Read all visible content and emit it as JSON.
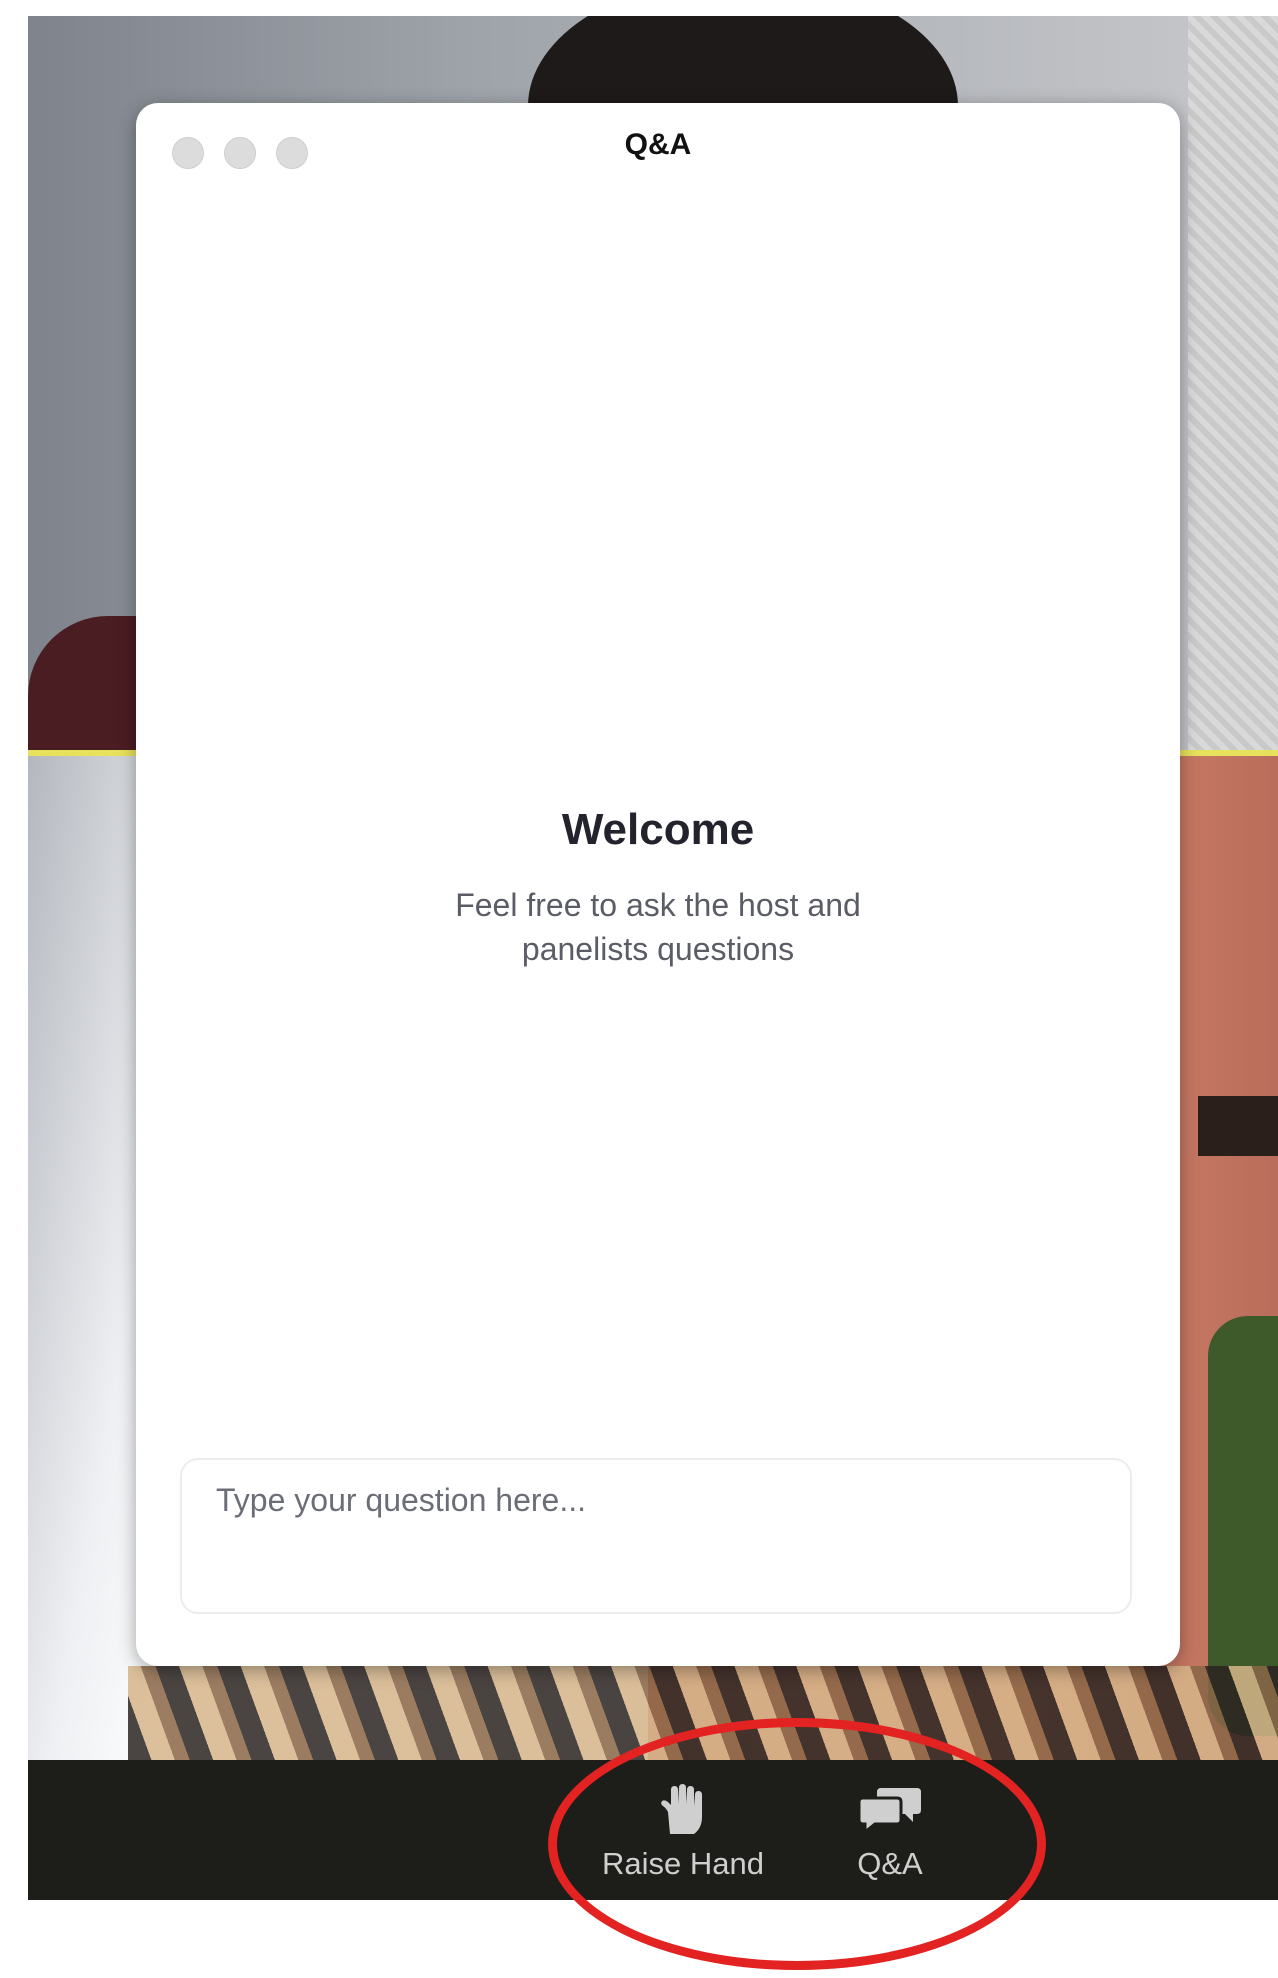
{
  "qa_window": {
    "title": "Q&A",
    "welcome_title": "Welcome",
    "welcome_text": "Feel free to ask the host and panelists questions",
    "question_placeholder": "Type your question here..."
  },
  "toolbar": {
    "raise_hand_label": "Raise Hand",
    "qa_label": "Q&A",
    "raise_hand_icon": "raise-hand-icon",
    "qa_icon": "qa-bubbles-icon"
  },
  "colors": {
    "annotation": "#e32222",
    "toolbar_bg": "#1d1d1a",
    "speaker_highlight": "#e6e25c"
  }
}
